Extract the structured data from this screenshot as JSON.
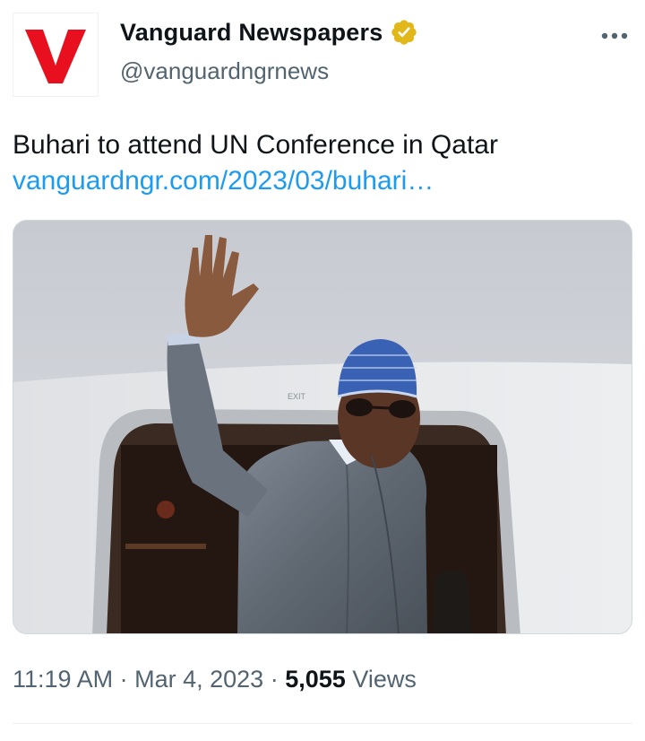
{
  "account": {
    "display_name": "Vanguard Newspapers",
    "handle": "@vanguardngrnews",
    "avatar_letter": "V",
    "avatar_color": "#e8101e",
    "verified_color": "#e2b719"
  },
  "tweet": {
    "text": "Buhari to attend UN Conference in Qatar",
    "link": "vanguardngr.com/2023/03/buhari…",
    "link_color": "#1d9bf0"
  },
  "media": {
    "icons": [
      "photo-man-waving-from-aircraft-door"
    ],
    "exit_sign": "EXIT"
  },
  "meta": {
    "time": "11:19 AM",
    "separator": "·",
    "date": "Mar 4, 2023",
    "views_count": "5,055",
    "views_label": "Views"
  },
  "icons": {
    "more": "more-horizontal-icon",
    "verified": "verified-badge-icon"
  }
}
